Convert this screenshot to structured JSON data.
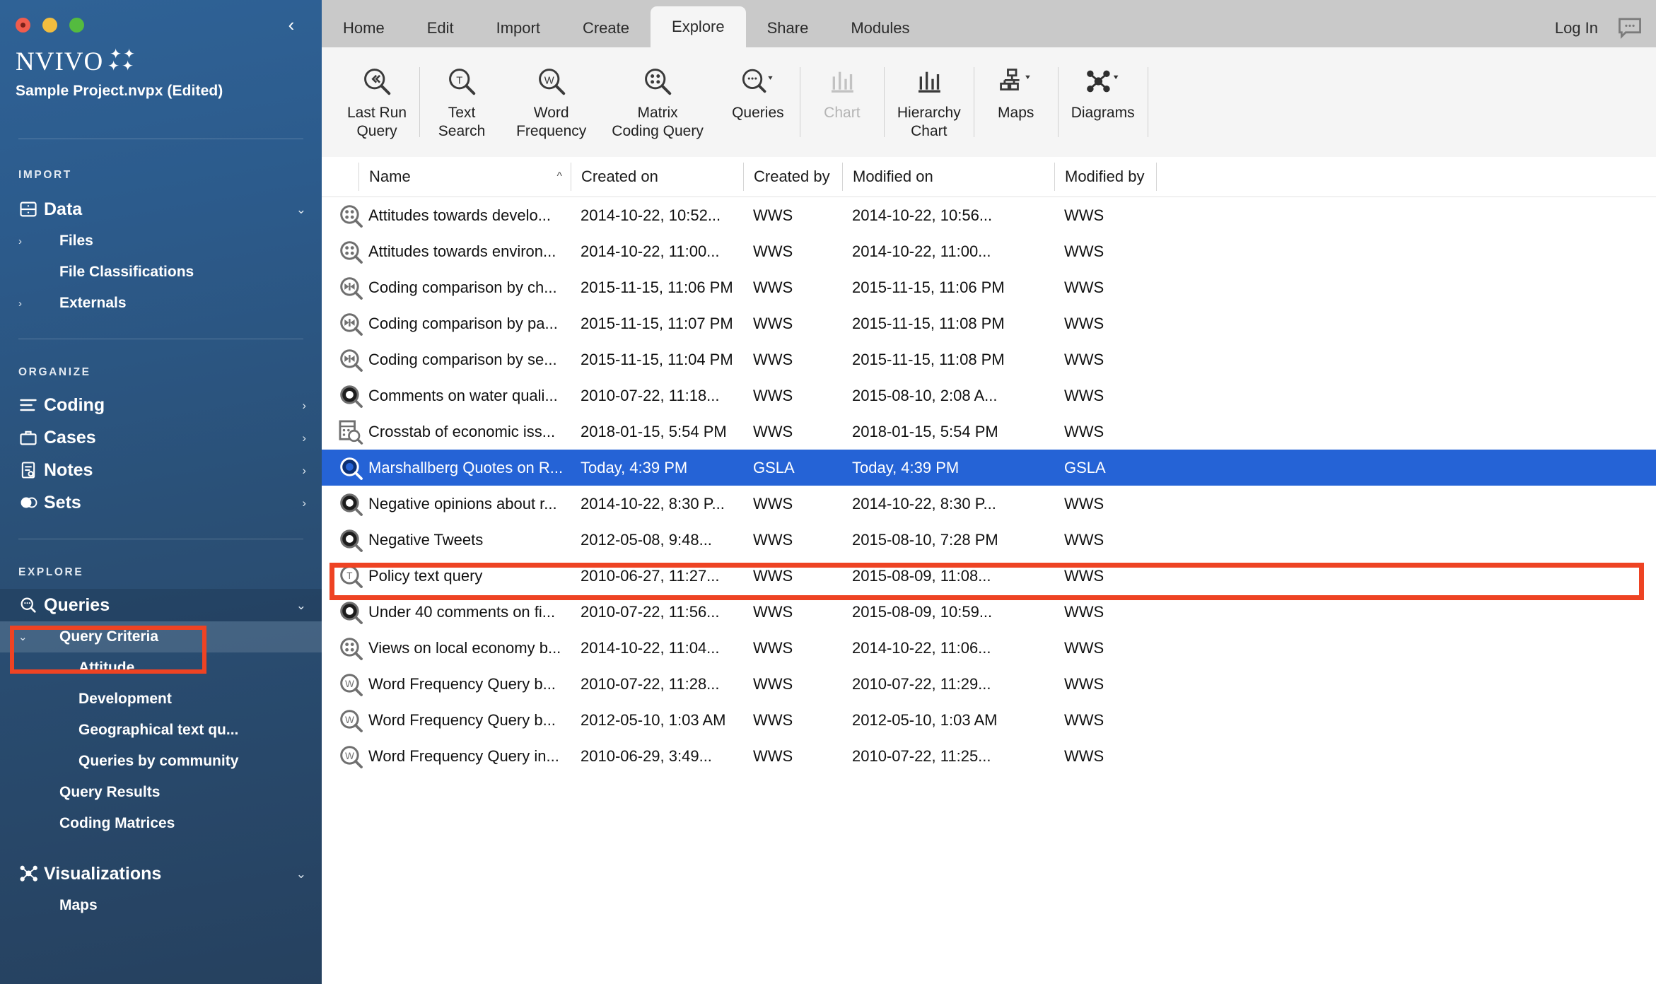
{
  "window": {
    "collapse_icon": "chevron-left-icon",
    "traffic_lights": [
      "close",
      "minimize",
      "zoom"
    ]
  },
  "sidebar": {
    "brand": "NVIVO",
    "project_name": "Sample Project.nvpx (Edited)",
    "sections": [
      {
        "label": "IMPORT",
        "items": [
          {
            "label": "Data",
            "icon": "database-icon",
            "chevron": "chevron-down-icon",
            "level": "top"
          },
          {
            "label": "Files",
            "twisty": "chevron-right-icon",
            "level": "sub"
          },
          {
            "label": "File Classifications",
            "twisty": "",
            "level": "sub"
          },
          {
            "label": "Externals",
            "twisty": "chevron-right-icon",
            "level": "sub"
          }
        ]
      },
      {
        "label": "ORGANIZE",
        "items": [
          {
            "label": "Coding",
            "icon": "list-icon",
            "chevron": "chevron-right-icon",
            "level": "top"
          },
          {
            "label": "Cases",
            "icon": "briefcase-icon",
            "chevron": "chevron-right-icon",
            "level": "top"
          },
          {
            "label": "Notes",
            "icon": "notes-icon",
            "chevron": "chevron-right-icon",
            "level": "top"
          },
          {
            "label": "Sets",
            "icon": "sets-icon",
            "chevron": "chevron-right-icon",
            "level": "top"
          }
        ]
      },
      {
        "label": "EXPLORE",
        "items": [
          {
            "label": "Queries",
            "icon": "query-search-icon",
            "chevron": "chevron-down-icon",
            "level": "top"
          },
          {
            "label": "Query Criteria",
            "twisty": "chevron-down-icon",
            "level": "sub",
            "selected": true
          },
          {
            "label": "Attitude",
            "level": "sub3"
          },
          {
            "label": "Development",
            "level": "sub3"
          },
          {
            "label": "Geographical text qu...",
            "level": "sub3"
          },
          {
            "label": "Queries by community",
            "level": "sub3"
          },
          {
            "label": "Query Results",
            "level": "sub"
          },
          {
            "label": "Coding Matrices",
            "level": "sub"
          },
          {
            "label": "Visualizations",
            "icon": "diagram-icon",
            "chevron": "chevron-down-icon",
            "level": "top"
          },
          {
            "label": "Maps",
            "level": "sub"
          }
        ]
      }
    ]
  },
  "tabs": [
    {
      "label": "Home",
      "active": false
    },
    {
      "label": "Edit",
      "active": false
    },
    {
      "label": "Import",
      "active": false
    },
    {
      "label": "Create",
      "active": false
    },
    {
      "label": "Explore",
      "active": true
    },
    {
      "label": "Share",
      "active": false
    },
    {
      "label": "Modules",
      "active": false
    }
  ],
  "header_right": {
    "login_label": "Log In",
    "chat_icon": "comment-bubble-icon"
  },
  "ribbon": [
    {
      "label": "Last Run\nQuery",
      "icon": "rewind-query-icon",
      "disabled": false,
      "sep_after": true
    },
    {
      "label": "Text\nSearch",
      "icon": "text-search-icon",
      "disabled": false
    },
    {
      "label": "Word\nFrequency",
      "icon": "word-frequency-icon",
      "disabled": false
    },
    {
      "label": "Matrix\nCoding Query",
      "icon": "matrix-coding-icon",
      "disabled": false
    },
    {
      "label": "Queries",
      "icon": "queries-icon",
      "disabled": false,
      "caret": true,
      "sep_after": true
    },
    {
      "label": "Chart",
      "icon": "chart-icon",
      "disabled": true,
      "sep_after": true
    },
    {
      "label": "Hierarchy\nChart",
      "icon": "hierarchy-chart-icon",
      "disabled": false,
      "sep_after": true
    },
    {
      "label": "Maps",
      "icon": "maps-icon",
      "disabled": false,
      "caret": true,
      "sep_after": true
    },
    {
      "label": "Diagrams",
      "icon": "diagrams-icon",
      "disabled": false,
      "caret": true,
      "sep_after": true
    }
  ],
  "table": {
    "columns": [
      {
        "key": "name",
        "label": "Name",
        "sort": "ascending"
      },
      {
        "key": "created_on",
        "label": "Created on"
      },
      {
        "key": "created_by",
        "label": "Created by"
      },
      {
        "key": "modified_on",
        "label": "Modified on"
      },
      {
        "key": "modified_by",
        "label": "Modified by"
      }
    ],
    "rows": [
      {
        "icon": "matrix-query-icon",
        "name": "Attitudes towards develo...",
        "created_on": "2014-10-22, 10:52...",
        "created_by": "WWS",
        "modified_on": "2014-10-22, 10:56...",
        "modified_by": "WWS",
        "selected": false
      },
      {
        "icon": "matrix-query-icon",
        "name": "Attitudes towards environ...",
        "created_on": "2014-10-22, 11:00...",
        "created_by": "WWS",
        "modified_on": "2014-10-22, 11:00...",
        "modified_by": "WWS",
        "selected": false
      },
      {
        "icon": "coding-comparison-icon",
        "name": "Coding comparison by ch...",
        "created_on": "2015-11-15, 11:06 PM",
        "created_by": "WWS",
        "modified_on": "2015-11-15, 11:06 PM",
        "modified_by": "WWS",
        "selected": false
      },
      {
        "icon": "coding-comparison-icon",
        "name": "Coding comparison by pa...",
        "created_on": "2015-11-15, 11:07 PM",
        "created_by": "WWS",
        "modified_on": "2015-11-15, 11:08 PM",
        "modified_by": "WWS",
        "selected": false
      },
      {
        "icon": "coding-comparison-icon",
        "name": "Coding comparison by se...",
        "created_on": "2015-11-15, 11:04 PM",
        "created_by": "WWS",
        "modified_on": "2015-11-15, 11:08 PM",
        "modified_by": "WWS",
        "selected": false
      },
      {
        "icon": "coding-query-icon",
        "name": "Comments on water quali...",
        "created_on": "2010-07-22, 11:18...",
        "created_by": "WWS",
        "modified_on": "2015-08-10, 2:08 A...",
        "modified_by": "WWS",
        "selected": false
      },
      {
        "icon": "crosstab-icon",
        "name": "Crosstab of economic iss...",
        "created_on": "2018-01-15, 5:54 PM",
        "created_by": "WWS",
        "modified_on": "2018-01-15, 5:54 PM",
        "modified_by": "WWS",
        "selected": false
      },
      {
        "icon": "coding-query-icon",
        "name": "Marshallberg Quotes on R...",
        "created_on": "Today, 4:39 PM",
        "created_by": "GSLA",
        "modified_on": "Today, 4:39 PM",
        "modified_by": "GSLA",
        "selected": true
      },
      {
        "icon": "coding-query-icon",
        "name": "Negative opinions about r...",
        "created_on": "2014-10-22, 8:30 P...",
        "created_by": "WWS",
        "modified_on": "2014-10-22, 8:30 P...",
        "modified_by": "WWS",
        "selected": false
      },
      {
        "icon": "coding-query-icon",
        "name": "Negative Tweets",
        "created_on": "2012-05-08, 9:48...",
        "created_by": "WWS",
        "modified_on": "2015-08-10, 7:28 PM",
        "modified_by": "WWS",
        "selected": false
      },
      {
        "icon": "text-query-icon",
        "name": "Policy text query",
        "created_on": "2010-06-27, 11:27...",
        "created_by": "WWS",
        "modified_on": "2015-08-09, 11:08...",
        "modified_by": "WWS",
        "selected": false
      },
      {
        "icon": "coding-query-icon",
        "name": "Under 40 comments on fi...",
        "created_on": "2010-07-22, 11:56...",
        "created_by": "WWS",
        "modified_on": "2015-08-09, 10:59...",
        "modified_by": "WWS",
        "selected": false
      },
      {
        "icon": "matrix-query-icon",
        "name": "Views on local economy b...",
        "created_on": "2014-10-22, 11:04...",
        "created_by": "WWS",
        "modified_on": "2014-10-22, 11:06...",
        "modified_by": "WWS",
        "selected": false
      },
      {
        "icon": "word-query-icon",
        "name": "Word Frequency Query b...",
        "created_on": "2010-07-22, 11:28...",
        "created_by": "WWS",
        "modified_on": "2010-07-22, 11:29...",
        "modified_by": "WWS",
        "selected": false
      },
      {
        "icon": "word-query-icon",
        "name": "Word Frequency Query b...",
        "created_on": "2012-05-10, 1:03 AM",
        "created_by": "WWS",
        "modified_on": "2012-05-10, 1:03 AM",
        "modified_by": "WWS",
        "selected": false
      },
      {
        "icon": "word-query-icon",
        "name": "Word Frequency Query in...",
        "created_on": "2010-06-29, 3:49...",
        "created_by": "WWS",
        "modified_on": "2010-07-22, 11:25...",
        "modified_by": "WWS",
        "selected": false
      }
    ]
  },
  "annotations": {
    "highlight_color": "#ee4323",
    "selection_color": "#2563d6",
    "sidebar_highlight_target": "Queries / Query Criteria",
    "row_highlight_target": "Marshallberg Quotes on R..."
  }
}
